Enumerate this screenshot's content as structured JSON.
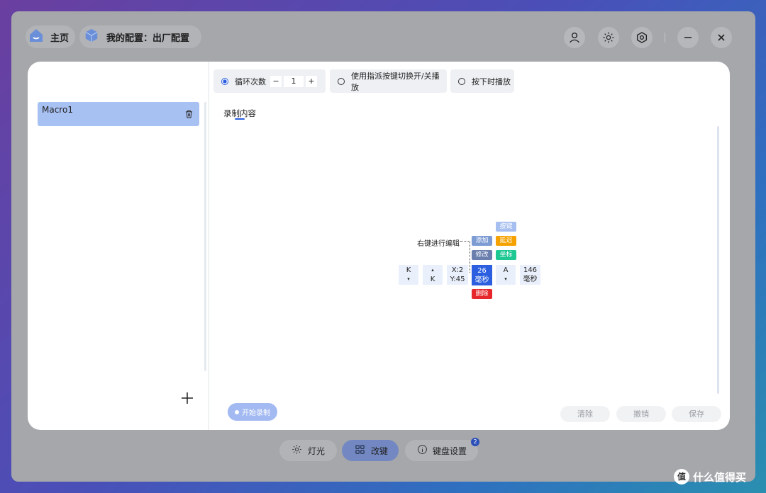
{
  "header": {
    "home_label": "主页",
    "config_label": "我的配置：出厂配置",
    "icons": [
      "home-icon",
      "cube-icon",
      "user-icon",
      "brightness-icon",
      "hexagon-settings-icon",
      "minimize-icon",
      "close-icon"
    ]
  },
  "sidebar": {
    "macros": [
      {
        "label": "Macro1"
      }
    ],
    "add_icon": "+"
  },
  "options": {
    "loop_label": "循环次数",
    "loop_count": "1",
    "loop_minus": "−",
    "loop_plus": "+",
    "toggle_label": "使用指派按键切换开/关播放",
    "hold_label": "按下时播放",
    "selected": "loop"
  },
  "record": {
    "title": "录制内容",
    "hint": "右键进行编辑",
    "events": [
      {
        "line1": "K",
        "line2": "▾"
      },
      {
        "line1": "▴",
        "line2": "K"
      },
      {
        "line1": "X:2",
        "line2": "Y:45"
      },
      {
        "line1": "26",
        "line2": "毫秒"
      },
      {
        "line1": "A",
        "line2": "▾"
      },
      {
        "line1": "146",
        "line2": "毫秒"
      }
    ],
    "menu": {
      "add": "添加",
      "modify": "修改",
      "delete": "删除",
      "key": "按键",
      "delay": "延迟",
      "coord": "坐标"
    }
  },
  "footer": {
    "start_record": "开始录制",
    "clear": "清除",
    "undo": "撤销",
    "save": "保存"
  },
  "tabs": {
    "lighting": "灯光",
    "remap": "改键",
    "keyboard_settings": "键盘设置",
    "badge": "2"
  },
  "watermark": {
    "symbol": "值",
    "text": "什么值得买"
  },
  "colors": {
    "accent": "#2b5fe0",
    "selected_item": "#a8c1f3",
    "delay_tag": "#f5a200",
    "coord_tag": "#1ec893",
    "delete_tag": "#e6262a"
  }
}
